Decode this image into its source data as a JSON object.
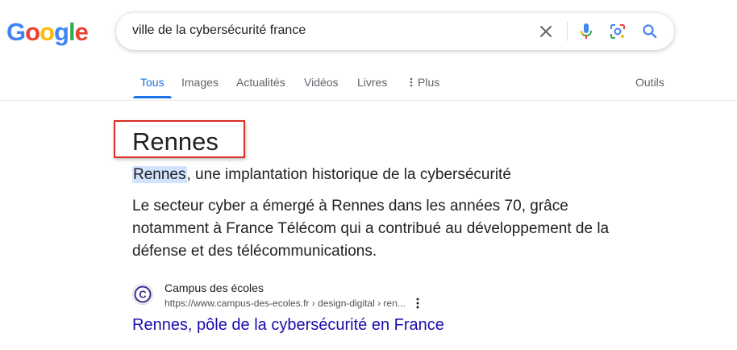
{
  "logo": {
    "letters": [
      "G",
      "o",
      "o",
      "g",
      "l",
      "e"
    ],
    "colors": [
      "#4285F4",
      "#EA4335",
      "#FBBC05",
      "#4285F4",
      "#34A853",
      "#EA4335"
    ]
  },
  "search": {
    "query": "ville de la cybersécurité france",
    "icons": [
      "close-icon",
      "microphone-icon",
      "lens-icon",
      "search-icon"
    ]
  },
  "tabs": [
    {
      "label": "Tous",
      "active": true
    },
    {
      "label": "Images"
    },
    {
      "label": "Actualités"
    },
    {
      "label": "Vidéos"
    },
    {
      "label": "Livres"
    },
    {
      "label": "Plus",
      "icon": "more-vert-icon"
    }
  ],
  "tools_label": "Outils",
  "featured": {
    "title": "Rennes",
    "subtitle_highlight": "Rennes",
    "subtitle_rest": ", une implantation historique de la cybersécurité",
    "description": "Le secteur cyber a émergé à Rennes dans les années 70, grâce notamment à France Télécom qui a contribué au développement de la défense et des télécommunications."
  },
  "source": {
    "favicon_letter": "C",
    "name": "Campus des écoles",
    "url": "https://www.campus-des-ecoles.fr › design-digital › ren...",
    "link_title": "Rennes, pôle de la cybersécurité en France"
  },
  "colors": {
    "accent": "#1a73e8",
    "link": "#1a0dab",
    "highlight_border": "#d93025",
    "text_highlight": "#d3e3fd"
  }
}
